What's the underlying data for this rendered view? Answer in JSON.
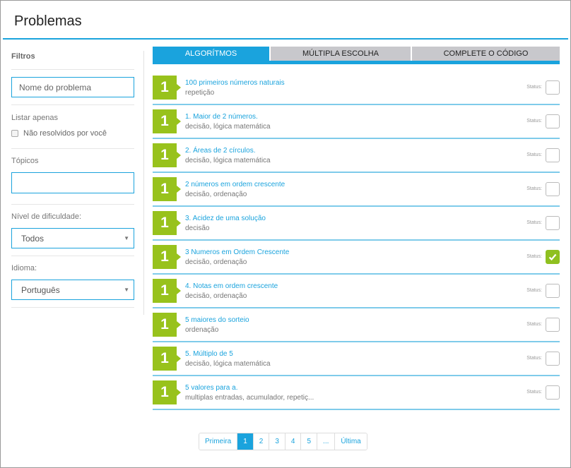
{
  "page": {
    "title": "Problemas"
  },
  "filters": {
    "title": "Filtros",
    "name_placeholder": "Nome do problema",
    "list_label": "Listar apenas",
    "unsolved_label": "Não resolvidos por você",
    "topics_label": "Tópicos",
    "topics_value": "",
    "difficulty_label": "Nível de dificuldade:",
    "difficulty_value": "Todos",
    "language_label": "Idioma:",
    "language_value": "Português"
  },
  "tabs": [
    {
      "label": "ALGORÍTMOS",
      "active": true
    },
    {
      "label": "MÚLTIPLA ESCOLHA",
      "active": false
    },
    {
      "label": "COMPLETE O CÓDIGO",
      "active": false
    }
  ],
  "status_label": "Status:",
  "problems": [
    {
      "level": "1",
      "name": "100 primeiros números naturais",
      "tags": "repetição",
      "solved": false
    },
    {
      "level": "1",
      "name": "1. Maior de 2 números.",
      "tags": "decisão, lógica matemática",
      "solved": false
    },
    {
      "level": "1",
      "name": "2. Áreas de 2 círculos.",
      "tags": "decisão, lógica matemática",
      "solved": false
    },
    {
      "level": "1",
      "name": "2 números em ordem crescente",
      "tags": "decisão, ordenação",
      "solved": false
    },
    {
      "level": "1",
      "name": "3. Acidez de uma solução",
      "tags": "decisão",
      "solved": false
    },
    {
      "level": "1",
      "name": "3 Numeros em Ordem Crescente",
      "tags": "decisão, ordenação",
      "solved": true
    },
    {
      "level": "1",
      "name": "4. Notas em ordem crescente",
      "tags": "decisão, ordenação",
      "solved": false
    },
    {
      "level": "1",
      "name": "5 maiores do sorteio",
      "tags": "ordenação",
      "solved": false
    },
    {
      "level": "1",
      "name": "5. Múltiplo de 5",
      "tags": "decisão, lógica matemática",
      "solved": false
    },
    {
      "level": "1",
      "name": "5 valores para a.",
      "tags": "multiplas entradas, acumulador, repetiç...",
      "solved": false
    }
  ],
  "pagination": {
    "first": "Primeira",
    "pages": [
      "1",
      "2",
      "3",
      "4",
      "5",
      "..."
    ],
    "active_page": "1",
    "last": "Última"
  },
  "colors": {
    "accent": "#1aa3dd",
    "badge": "#98c21c",
    "tab_inactive": "#c8c8cc"
  },
  "icons": {
    "solved": "check-icon",
    "dropdown": "caret-down-icon"
  }
}
